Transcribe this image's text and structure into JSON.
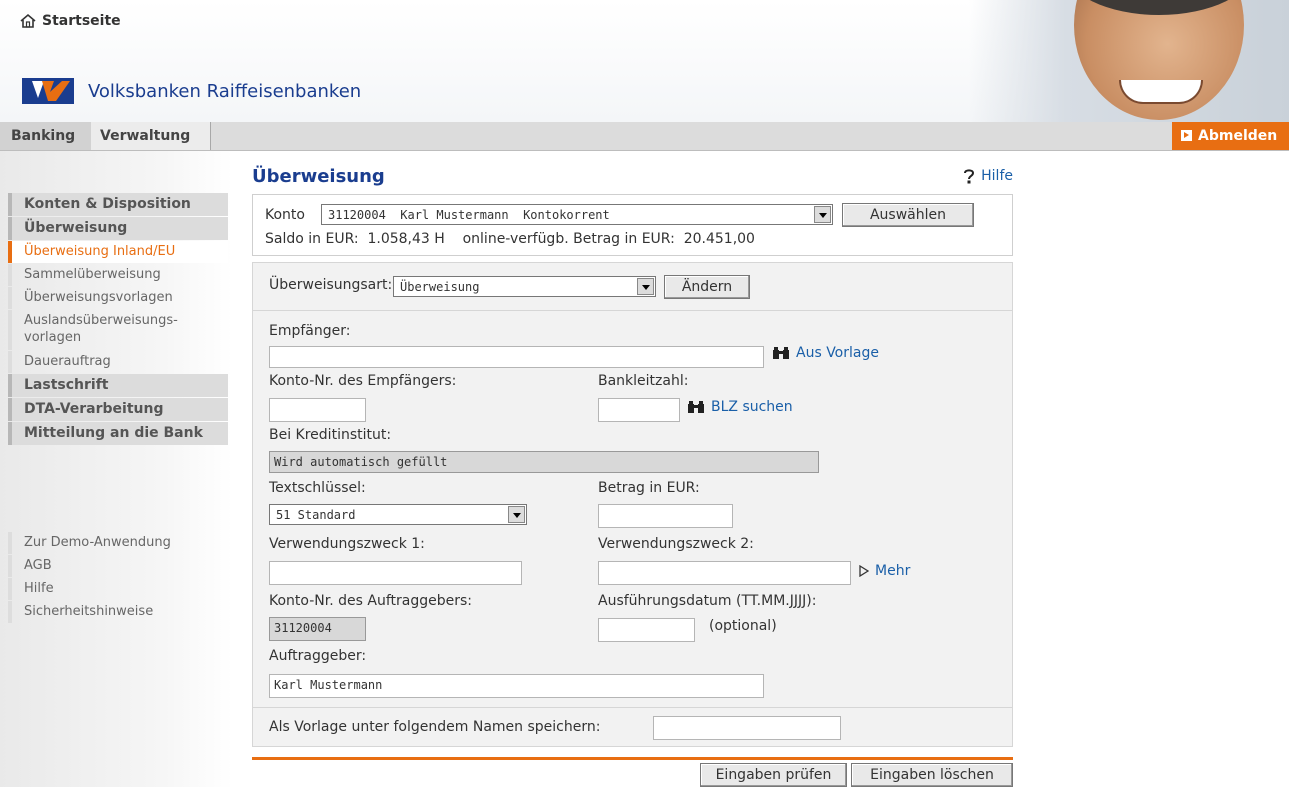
{
  "header": {
    "home_label": "Startseite",
    "brand_name": "Volksbanken Raiffeisenbanken",
    "brand_color": "#1a3d8f",
    "accent_color": "#e86e12"
  },
  "tabs": {
    "banking": "Banking",
    "verwaltung": "Verwaltung",
    "logout": "Abmelden"
  },
  "sidebar": {
    "konten": "Konten & Disposition",
    "ueberweisung": "Überweisung",
    "inland": "Überweisung Inland/EU",
    "sammel": "Sammelüberweisung",
    "vorlagen": "Überweisungsvorlagen",
    "ausland_1": "Auslandsüberweisungs-",
    "ausland_2": "vorlagen",
    "dauerauftrag": "Dauerauftrag",
    "lastschrift": "Lastschrift",
    "dta": "DTA-Verarbeitung",
    "mitteilung": "Mitteilung an die Bank",
    "demo": "Zur Demo-Anwendung",
    "agb": "AGB",
    "hilfe": "Hilfe",
    "sicherheit": "Sicherheitshinweise"
  },
  "main": {
    "title": "Überweisung",
    "help": "Hilfe",
    "konto_label": "Konto",
    "konto_value": "31120004  Karl Mustermann  Kontokorrent",
    "auswaehlen": "Auswählen",
    "saldo": "Saldo in EUR:  1.058,43 H    online-verfügb. Betrag in EUR:  20.451,00",
    "art_label": "Überweisungsart:",
    "art_value": "Überweisung",
    "aendern": "Ändern",
    "empfaenger_label": "Empfänger:",
    "aus_vorlage": "Aus Vorlage",
    "konto_nr_label": "Konto-Nr. des Empfängers:",
    "blz_label": "Bankleitzahl:",
    "blz_suchen": "BLZ suchen",
    "kredit_label": "Bei Kreditinstitut:",
    "kredit_value": "Wird automatisch gefüllt",
    "textschluessel_label": "Textschlüssel:",
    "textschluessel_value": "51 Standard",
    "betrag_label": "Betrag in EUR:",
    "zweck1_label": "Verwendungszweck 1:",
    "zweck2_label": "Verwendungszweck 2:",
    "mehr": "Mehr",
    "auftraggeber_konto_label": "Konto-Nr. des Auftraggebers:",
    "auftraggeber_konto_value": "31120004",
    "datum_label": "Ausführungsdatum (TT.MM.JJJJ):",
    "optional": "(optional)",
    "auftraggeber_label": "Auftraggeber:",
    "auftraggeber_value": "Karl Mustermann",
    "vorlage_label": "Als Vorlage unter folgendem Namen speichern:",
    "pruefen": "Eingaben prüfen",
    "loeschen": "Eingaben löschen"
  }
}
